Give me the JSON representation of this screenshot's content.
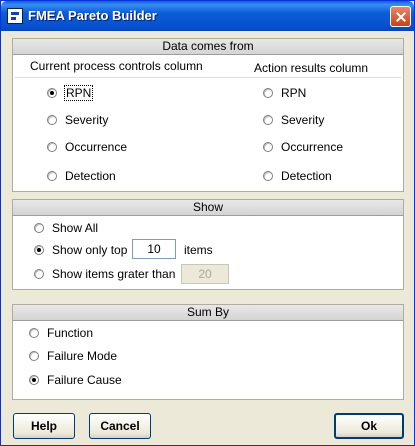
{
  "window": {
    "title": "FMEA Pareto Builder"
  },
  "data_source": {
    "header": "Data comes from",
    "left_heading": "Current process controls column",
    "right_heading": "Action results column",
    "left_options": [
      "RPN",
      "Severity",
      "Occurrence",
      "Detection"
    ],
    "right_options": [
      "RPN",
      "Severity",
      "Occurrence",
      "Detection"
    ],
    "left_selected": "RPN"
  },
  "show": {
    "header": "Show",
    "option_all": "Show All",
    "option_top": "Show only top",
    "top_value": "10",
    "top_suffix": "items",
    "option_greater": "Show items grater than",
    "greater_value": "20",
    "selected": "Show only top"
  },
  "sum_by": {
    "header": "Sum By",
    "options": [
      "Function",
      "Failure Mode",
      "Failure Cause"
    ],
    "selected": "Failure Cause"
  },
  "footer": {
    "help_label": "Help",
    "cancel_label": "Cancel",
    "ok_label": "Ok"
  }
}
